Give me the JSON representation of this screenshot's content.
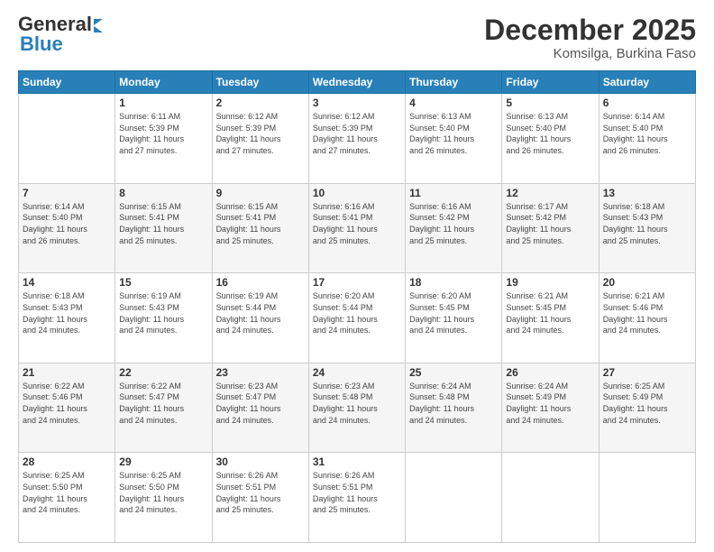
{
  "header": {
    "logo_line1": "General",
    "logo_line2": "Blue",
    "month": "December 2025",
    "location": "Komsilga, Burkina Faso"
  },
  "days_of_week": [
    "Sunday",
    "Monday",
    "Tuesday",
    "Wednesday",
    "Thursday",
    "Friday",
    "Saturday"
  ],
  "weeks": [
    [
      {
        "day": "",
        "info": ""
      },
      {
        "day": "1",
        "info": "Sunrise: 6:11 AM\nSunset: 5:39 PM\nDaylight: 11 hours\nand 27 minutes."
      },
      {
        "day": "2",
        "info": "Sunrise: 6:12 AM\nSunset: 5:39 PM\nDaylight: 11 hours\nand 27 minutes."
      },
      {
        "day": "3",
        "info": "Sunrise: 6:12 AM\nSunset: 5:39 PM\nDaylight: 11 hours\nand 27 minutes."
      },
      {
        "day": "4",
        "info": "Sunrise: 6:13 AM\nSunset: 5:40 PM\nDaylight: 11 hours\nand 26 minutes."
      },
      {
        "day": "5",
        "info": "Sunrise: 6:13 AM\nSunset: 5:40 PM\nDaylight: 11 hours\nand 26 minutes."
      },
      {
        "day": "6",
        "info": "Sunrise: 6:14 AM\nSunset: 5:40 PM\nDaylight: 11 hours\nand 26 minutes."
      }
    ],
    [
      {
        "day": "7",
        "info": "Sunrise: 6:14 AM\nSunset: 5:40 PM\nDaylight: 11 hours\nand 26 minutes."
      },
      {
        "day": "8",
        "info": "Sunrise: 6:15 AM\nSunset: 5:41 PM\nDaylight: 11 hours\nand 25 minutes."
      },
      {
        "day": "9",
        "info": "Sunrise: 6:15 AM\nSunset: 5:41 PM\nDaylight: 11 hours\nand 25 minutes."
      },
      {
        "day": "10",
        "info": "Sunrise: 6:16 AM\nSunset: 5:41 PM\nDaylight: 11 hours\nand 25 minutes."
      },
      {
        "day": "11",
        "info": "Sunrise: 6:16 AM\nSunset: 5:42 PM\nDaylight: 11 hours\nand 25 minutes."
      },
      {
        "day": "12",
        "info": "Sunrise: 6:17 AM\nSunset: 5:42 PM\nDaylight: 11 hours\nand 25 minutes."
      },
      {
        "day": "13",
        "info": "Sunrise: 6:18 AM\nSunset: 5:43 PM\nDaylight: 11 hours\nand 25 minutes."
      }
    ],
    [
      {
        "day": "14",
        "info": "Sunrise: 6:18 AM\nSunset: 5:43 PM\nDaylight: 11 hours\nand 24 minutes."
      },
      {
        "day": "15",
        "info": "Sunrise: 6:19 AM\nSunset: 5:43 PM\nDaylight: 11 hours\nand 24 minutes."
      },
      {
        "day": "16",
        "info": "Sunrise: 6:19 AM\nSunset: 5:44 PM\nDaylight: 11 hours\nand 24 minutes."
      },
      {
        "day": "17",
        "info": "Sunrise: 6:20 AM\nSunset: 5:44 PM\nDaylight: 11 hours\nand 24 minutes."
      },
      {
        "day": "18",
        "info": "Sunrise: 6:20 AM\nSunset: 5:45 PM\nDaylight: 11 hours\nand 24 minutes."
      },
      {
        "day": "19",
        "info": "Sunrise: 6:21 AM\nSunset: 5:45 PM\nDaylight: 11 hours\nand 24 minutes."
      },
      {
        "day": "20",
        "info": "Sunrise: 6:21 AM\nSunset: 5:46 PM\nDaylight: 11 hours\nand 24 minutes."
      }
    ],
    [
      {
        "day": "21",
        "info": "Sunrise: 6:22 AM\nSunset: 5:46 PM\nDaylight: 11 hours\nand 24 minutes."
      },
      {
        "day": "22",
        "info": "Sunrise: 6:22 AM\nSunset: 5:47 PM\nDaylight: 11 hours\nand 24 minutes."
      },
      {
        "day": "23",
        "info": "Sunrise: 6:23 AM\nSunset: 5:47 PM\nDaylight: 11 hours\nand 24 minutes."
      },
      {
        "day": "24",
        "info": "Sunrise: 6:23 AM\nSunset: 5:48 PM\nDaylight: 11 hours\nand 24 minutes."
      },
      {
        "day": "25",
        "info": "Sunrise: 6:24 AM\nSunset: 5:48 PM\nDaylight: 11 hours\nand 24 minutes."
      },
      {
        "day": "26",
        "info": "Sunrise: 6:24 AM\nSunset: 5:49 PM\nDaylight: 11 hours\nand 24 minutes."
      },
      {
        "day": "27",
        "info": "Sunrise: 6:25 AM\nSunset: 5:49 PM\nDaylight: 11 hours\nand 24 minutes."
      }
    ],
    [
      {
        "day": "28",
        "info": "Sunrise: 6:25 AM\nSunset: 5:50 PM\nDaylight: 11 hours\nand 24 minutes."
      },
      {
        "day": "29",
        "info": "Sunrise: 6:25 AM\nSunset: 5:50 PM\nDaylight: 11 hours\nand 24 minutes."
      },
      {
        "day": "30",
        "info": "Sunrise: 6:26 AM\nSunset: 5:51 PM\nDaylight: 11 hours\nand 25 minutes."
      },
      {
        "day": "31",
        "info": "Sunrise: 6:26 AM\nSunset: 5:51 PM\nDaylight: 11 hours\nand 25 minutes."
      },
      {
        "day": "",
        "info": ""
      },
      {
        "day": "",
        "info": ""
      },
      {
        "day": "",
        "info": ""
      }
    ]
  ]
}
